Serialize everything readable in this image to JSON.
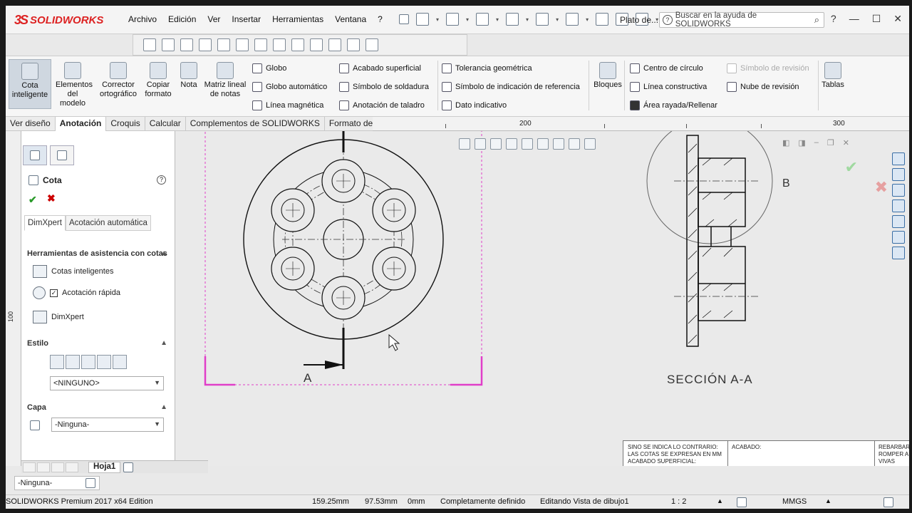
{
  "app": {
    "brand": "SOLIDWORKS",
    "brand_prefix": "3S",
    "doc_title": "Plato de..."
  },
  "menu": [
    "Archivo",
    "Edición",
    "Ver",
    "Insertar",
    "Herramientas",
    "Ventana",
    "?"
  ],
  "search": {
    "placeholder": "Buscar en la ayuda de SOLIDWORKS"
  },
  "ribbon": {
    "cota_inteligente": "Cota inteligente",
    "elementos_modelo": "Elementos del modelo",
    "corrector": "Corrector ortográfico",
    "copiar_formato": "Copiar formato",
    "nota": "Nota",
    "matriz_lineal": "Matriz lineal de notas",
    "globo": "Globo",
    "globo_auto": "Globo automático",
    "linea_magnetica": "Línea magnética",
    "acabado": "Acabado superficial",
    "soldadura": "Símbolo de soldadura",
    "taladro": "Anotación de taladro",
    "tolerancia": "Tolerancia geométrica",
    "indicacion_ref": "Símbolo de indicación de referencia",
    "dato_indicativo": "Dato indicativo",
    "bloques": "Bloques",
    "centro_circulo": "Centro de círculo",
    "linea_constructiva": "Línea constructiva",
    "area_rayada": "Área rayada/Rellenar",
    "simbolo_revision": "Símbolo de revisión",
    "nube_revision": "Nube de revisión",
    "tablas": "Tablas"
  },
  "tabs": [
    "Ver diseño",
    "Anotación",
    "Croquis",
    "Calcular",
    "Complementos de SOLIDWORKS",
    "Formato de hoja"
  ],
  "ruler": {
    "h": [
      "200",
      "300"
    ],
    "v": "100"
  },
  "pm": {
    "title": "Cota",
    "subtabs": [
      "DimXpert",
      "Acotación automática"
    ],
    "section_tools": "Herramientas de asistencia con cotas",
    "tools": [
      "Cotas inteligentes",
      "Acotación rápida",
      "DimXpert"
    ],
    "section_style": "Estilo",
    "style_value": "<NINGUNO>",
    "section_layer": "Capa",
    "layer_value": "-Ninguna-"
  },
  "sheet_tab": "Hoja1",
  "bottom_layer": "-Ninguna-",
  "drawing": {
    "section_label_A": "A",
    "section_label_B": "B",
    "section_title": "SECCIÓN A-A",
    "titleblock_1": "SINO SE INDICA LO CONTRARIO:",
    "titleblock_2": "LAS COTAS SE EXPRESAN EN MM",
    "titleblock_3": "ACABADO SUPERFICIAL:",
    "titleblock_4": "ACABADO:",
    "titleblock_5": "REBARBAR Y",
    "titleblock_6": "ROMPER A",
    "titleblock_7": "VIVAS"
  },
  "status": {
    "edition": "SOLIDWORKS Premium 2017 x64 Edition",
    "x": "159.25mm",
    "y": "97.53mm",
    "z": "0mm",
    "state": "Completamente definido",
    "edit": "Editando Vista de dibujo1",
    "scale": "1 : 2",
    "units": "MMGS"
  }
}
